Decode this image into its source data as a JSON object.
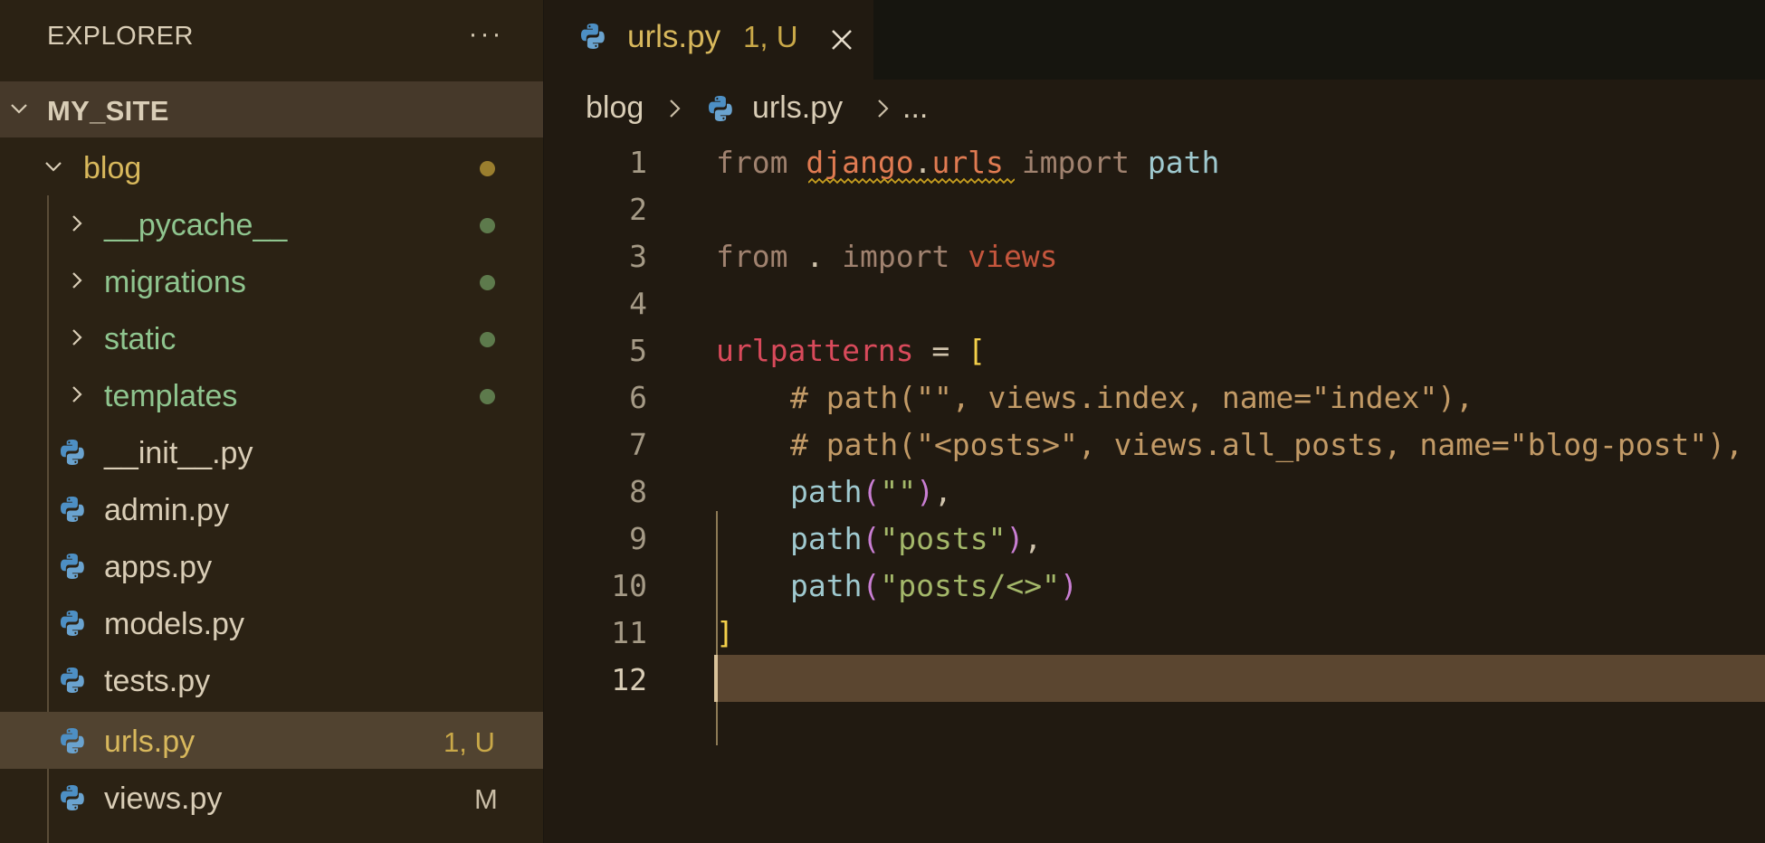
{
  "explorer": {
    "title": "EXPLORER",
    "more_label": "···",
    "project": "MY_SITE",
    "folder": {
      "name": "blog"
    },
    "subfolders": [
      {
        "name": "__pycache__"
      },
      {
        "name": "migrations"
      },
      {
        "name": "static"
      },
      {
        "name": "templates"
      }
    ],
    "files": [
      {
        "name": "__init__.py",
        "badge": ""
      },
      {
        "name": "admin.py",
        "badge": ""
      },
      {
        "name": "apps.py",
        "badge": ""
      },
      {
        "name": "models.py",
        "badge": ""
      },
      {
        "name": "tests.py",
        "badge": ""
      },
      {
        "name": "urls.py",
        "badge": "1, U"
      },
      {
        "name": "views.py",
        "badge": "M"
      }
    ]
  },
  "tab": {
    "title": "urls.py",
    "badge": "1, U"
  },
  "breadcrumb": {
    "folder": "blog",
    "file": "urls.py",
    "more": "..."
  },
  "code": {
    "line_numbers": [
      "1",
      "2",
      "3",
      "4",
      "5",
      "6",
      "7",
      "8",
      "9",
      "10",
      "11",
      "12"
    ],
    "current_line": 12,
    "l1": {
      "kw1": "from",
      "mod1": "django",
      "dot": ".",
      "mod2": "urls",
      "kw2": "import",
      "ident": "path"
    },
    "l3": {
      "kw1": "from",
      "dot": ".",
      "kw2": "import",
      "ident": "views"
    },
    "l5": {
      "var": "urlpatterns",
      "op": "=",
      "br": "["
    },
    "l6": {
      "comment": "# path(\"\", views.index, name=\"index\"),"
    },
    "l7": {
      "comment": "# path(\"<posts>\", views.all_posts, name=\"blog-post\"),"
    },
    "l8": {
      "fn": "path",
      "open": "(",
      "str": "\"\"",
      "close": ")",
      "tail": ","
    },
    "l9": {
      "fn": "path",
      "open": "(",
      "str": "\"posts\"",
      "close": ")",
      "tail": ","
    },
    "l10": {
      "fn": "path",
      "open": "(",
      "str": "\"posts/<>\"",
      "close": ")"
    },
    "l11": {
      "br": "]"
    }
  },
  "colors": {
    "accent_modified": "#d8b85c",
    "untracked_folder": "#8fc58f",
    "sidebar_bg": "#2b2214",
    "editor_bg": "#211a11"
  },
  "icons": {
    "python": "python-file-icon",
    "close": "close-icon",
    "chevron_right": "chevron-right-icon",
    "chevron_down": "chevron-down-icon",
    "more": "more-actions-icon"
  }
}
